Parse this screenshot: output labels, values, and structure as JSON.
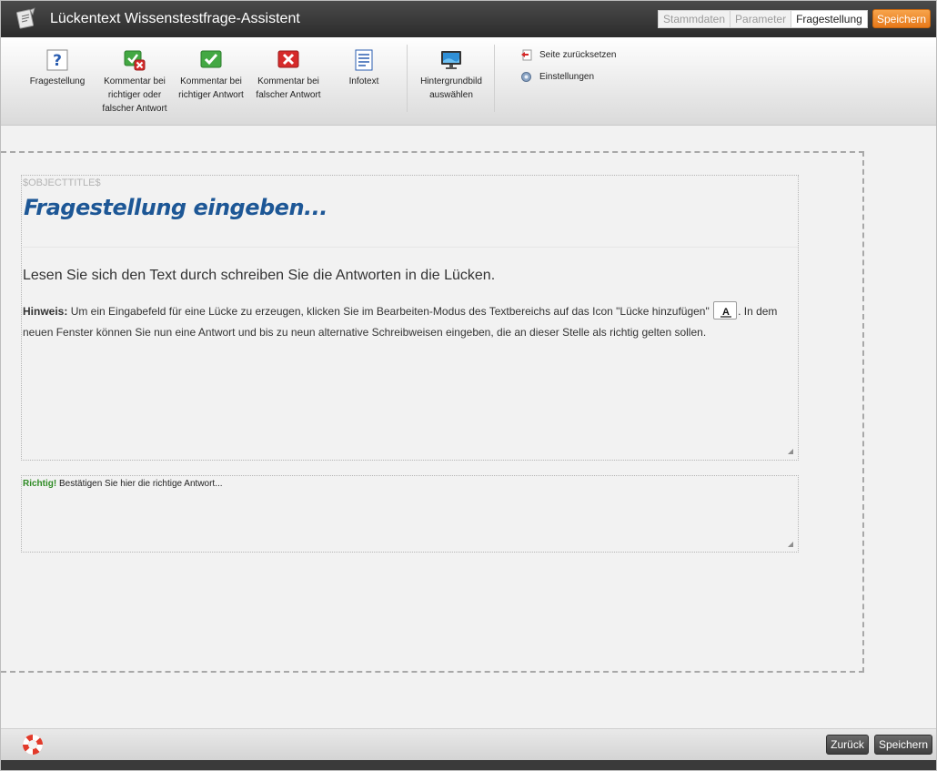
{
  "window": {
    "title": "Lückentext Wissenstestfrage-Assistent"
  },
  "steps": [
    {
      "label": "Stammdaten",
      "active": false
    },
    {
      "label": "Parameter",
      "active": false
    },
    {
      "label": "Fragestellung",
      "active": true
    }
  ],
  "header": {
    "save_label": "Speichern"
  },
  "ribbon": {
    "buttons": [
      {
        "label": "Fragestellung",
        "icon": "question-icon"
      },
      {
        "label": "Kommentar bei richtiger oder falscher Antwort",
        "icon": "right-wrong-comment-icon"
      },
      {
        "label": "Kommentar bei richtiger Antwort",
        "icon": "check-icon"
      },
      {
        "label": "Kommentar bei falscher Antwort",
        "icon": "cross-icon"
      },
      {
        "label": "Infotext",
        "icon": "document-icon"
      },
      {
        "label": "Hintergrundbild auswählen",
        "icon": "monitor-icon"
      }
    ],
    "links": [
      {
        "label": "Seite zurücksetzen",
        "icon": "reset-icon"
      },
      {
        "label": "Einstellungen",
        "icon": "gear-icon"
      }
    ]
  },
  "content": {
    "object_title_placeholder": "$OBJECTTITLE$",
    "question_title": "Fragestellung eingeben...",
    "instruction": "Lesen Sie sich den Text durch schreiben Sie die Antworten in die Lücken.",
    "hint_label": "Hinweis:",
    "hint_text_1": "Um ein Eingabefeld für eine Lücke zu erzeugen, klicken Sie im Bearbeiten-Modus des Textbereichs auf das Icon \"Lücke hinzufügen\"",
    "hint_icon_glyph": "A",
    "hint_text_2": ". In dem neuen Fenster können Sie nun eine Antwort und bis zu neun alternative Schreibweisen eingeben, die an dieser Stelle als richtig gelten sollen.",
    "feedback_label": "Richtig!",
    "feedback_text": "Bestätigen Sie hier die richtige Antwort..."
  },
  "footer": {
    "help_icon": "lifebuoy-icon",
    "back_label": "Zurück",
    "save_label": "Speichern"
  },
  "colors": {
    "title_blue": "#1d5796",
    "accent_orange": "#f08a24",
    "correct_green": "#2e8b24"
  }
}
